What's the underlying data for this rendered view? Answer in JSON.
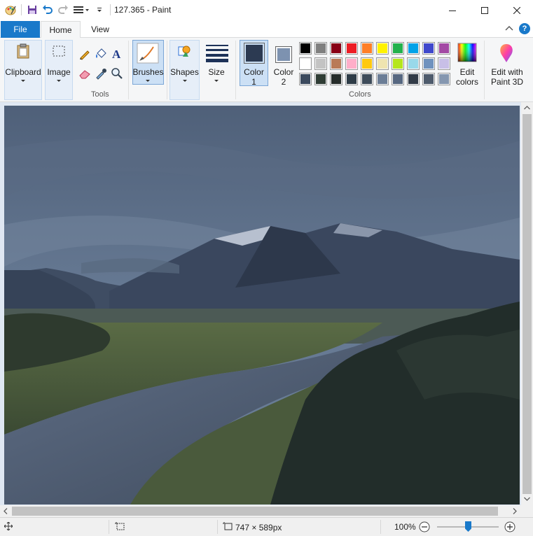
{
  "window": {
    "title": "127.365 - Paint"
  },
  "tabs": {
    "file": "File",
    "home": "Home",
    "view": "View"
  },
  "ribbon": {
    "clipboard": "Clipboard",
    "image": "Image",
    "tools_group": "Tools",
    "brushes": "Brushes",
    "shapes": "Shapes",
    "size": "Size",
    "color1_line1": "Color",
    "color1_line2": "1",
    "color2_line1": "Color",
    "color2_line2": "2",
    "edit_colors_line1": "Edit",
    "edit_colors_line2": "colors",
    "colors_group": "Colors",
    "edit3d_line1": "Edit with",
    "edit3d_line2": "Paint 3D"
  },
  "colors": {
    "color1": "#2c3a52",
    "color2": "#7d92b0",
    "palette_row1": [
      "#000000",
      "#7f7f7f",
      "#880015",
      "#ed1c24",
      "#ff7f27",
      "#fff200",
      "#22b14c",
      "#00a2e8",
      "#3f48cc",
      "#a349a4"
    ],
    "palette_row2": [
      "#ffffff",
      "#c3c3c3",
      "#b97a57",
      "#ffaec9",
      "#ffc90e",
      "#efe4b0",
      "#b5e61d",
      "#99d9ea",
      "#7092be",
      "#c8bfe7"
    ],
    "palette_row3": [
      "#3b4a5e",
      "#2f3d35",
      "#252c2a",
      "#2e3c47",
      "#3e4c5a",
      "#6b7d96",
      "#566780",
      "#323b47",
      "#4e5b6c",
      "#8597b0"
    ]
  },
  "status": {
    "image_size": "747 × 589px",
    "zoom": "100%"
  },
  "zoom": {
    "level_percent": 100
  }
}
